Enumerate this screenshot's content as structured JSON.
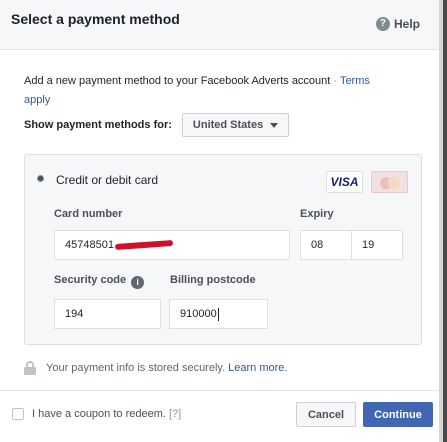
{
  "header": {
    "title": "Select a payment method",
    "help_label": "Help",
    "help_icon_glyph": "?"
  },
  "intro": {
    "text": "Add a new payment method to your Facebook Adverts account",
    "separator": " · ",
    "terms_link_part1": "Terms",
    "terms_link_part2": "apply"
  },
  "payment_methods_for": {
    "label": "Show payment methods for:",
    "selected_country": "United States"
  },
  "card_form": {
    "method_label": "Credit or debit card",
    "brands": {
      "visa_label": "VISA",
      "mastercard_icon": "mastercard-icon"
    },
    "card_number_label": "Card number",
    "card_number_value": "45748501",
    "expiry_label": "Expiry",
    "expiry_month": "08",
    "expiry_year": "19",
    "security_code_label": "Security code",
    "security_info_glyph": "i",
    "security_code_value": "194",
    "billing_postcode_label": "Billing postcode",
    "billing_postcode_value": "910000"
  },
  "secure_note": {
    "text": "Your payment info is stored securely.",
    "learn_more": "Learn more."
  },
  "footer": {
    "coupon_label": "I have a coupon to redeem.",
    "coupon_help": "[?]",
    "cancel_label": "Cancel",
    "continue_label": "Continue"
  },
  "colors": {
    "primary_blue": "#4267b2",
    "link_blue": "#365899",
    "redaction_red": "#d0102a"
  }
}
